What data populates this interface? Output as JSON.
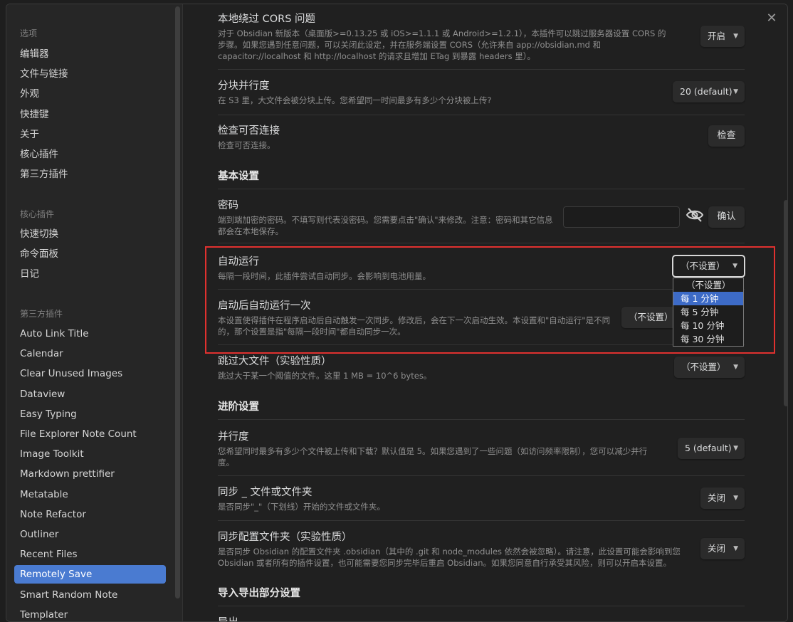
{
  "sidebar": {
    "options_group": "选项",
    "options": [
      "编辑器",
      "文件与链接",
      "外观",
      "快捷键",
      "关于",
      "核心插件",
      "第三方插件"
    ],
    "core_group": "核心插件",
    "core": [
      "快速切换",
      "命令面板",
      "日记"
    ],
    "community_group": "第三方插件",
    "community": [
      "Auto Link Title",
      "Calendar",
      "Clear Unused Images",
      "Dataview",
      "Easy Typing",
      "File Explorer Note Count",
      "Image Toolkit",
      "Markdown prettifier",
      "Metatable",
      "Note Refactor",
      "Outliner",
      "Recent Files",
      "Remotely Save",
      "Smart Random Note",
      "Templater"
    ],
    "active": "Remotely Save"
  },
  "settings": {
    "cors": {
      "name": "本地绕过 CORS 问题",
      "desc": "对于 Obsidian 新版本（桌面版>=0.13.25 或 iOS>=1.1.1 或 Android>=1.2.1），本插件可以跳过服务器设置 CORS 的步骤。如果您遇到任意问题，可以关闭此设定，并在服务端设置 CORS（允许来自 app://obsidian.md 和 capacitor://localhost 和 http://localhost 的请求且增加 ETag 到暴露 headers 里）。",
      "value": "开启"
    },
    "multipart": {
      "name": "分块并行度",
      "desc": "在 S3 里，大文件会被分块上传。您希望同一时间最多有多少个分块被上传?",
      "value": "20 (default)"
    },
    "check": {
      "name": "检查可否连接",
      "desc": "检查可否连接。",
      "button": "检查"
    },
    "basic_heading": "基本设置",
    "password": {
      "name": "密码",
      "desc": "端到端加密的密码。不填写则代表没密码。您需要点击\"确认\"来修改。注意：密码和其它信息都会在本地保存。",
      "value": "",
      "button": "确认"
    },
    "auto_run": {
      "name": "自动运行",
      "desc": "每隔一段时间，此插件尝试自动同步。会影响到电池用量。",
      "value": "（不设置）",
      "options": [
        "（不设置）",
        "每 1 分钟",
        "每 5 分钟",
        "每 10 分钟",
        "每 30 分钟"
      ],
      "highlighted": "每 1 分钟"
    },
    "auto_run_once": {
      "name": "启动后自动运行一次",
      "desc": "本设置使得插件在程序启动后自动触发一次同步。修改后，会在下一次启动生效。本设置和\"自动运行\"是不同的，那个设置是指\"每隔一段时间\"都自动同步一次。",
      "value": "（不设置）"
    },
    "skip_large": {
      "name": "跳过大文件（实验性质）",
      "desc": "跳过大于某一个阈值的文件。这里 1 MB = 10^6 bytes。",
      "value": "（不设置）"
    },
    "advanced_heading": "进阶设置",
    "concurrency": {
      "name": "并行度",
      "desc": "您希望同时最多有多少个文件被上传和下载？默认值是 5。如果您遇到了一些问题（如访问频率限制），您可以减少并行度。",
      "value": "5 (default)"
    },
    "sync_underscore": {
      "name": "同步 _ 文件或文件夹",
      "desc": "是否同步\"_\"（下划线）开始的文件或文件夹。",
      "value": "关闭"
    },
    "sync_config": {
      "name": "同步配置文件夹（实验性质）",
      "desc": "是否同步 Obsidian 的配置文件夹 .obsidian（其中的 .git 和 node_modules 依然会被忽略）。请注意，此设置可能会影响到您 Obsidian 或者所有的插件设置，也可能需要您同步完毕后重启 Obsidian。如果您同意自行承受其风险，则可以开启本设置。",
      "value": "关闭"
    },
    "import_export_heading": "导入导出部分设置",
    "export_partial": "导出"
  },
  "icons": {
    "close": "close-icon",
    "eye_off": "eye-off-icon",
    "caret": "chevron-down-icon"
  },
  "colors": {
    "accent": "#4a7bd1",
    "highlight_border": "#e0312f"
  }
}
